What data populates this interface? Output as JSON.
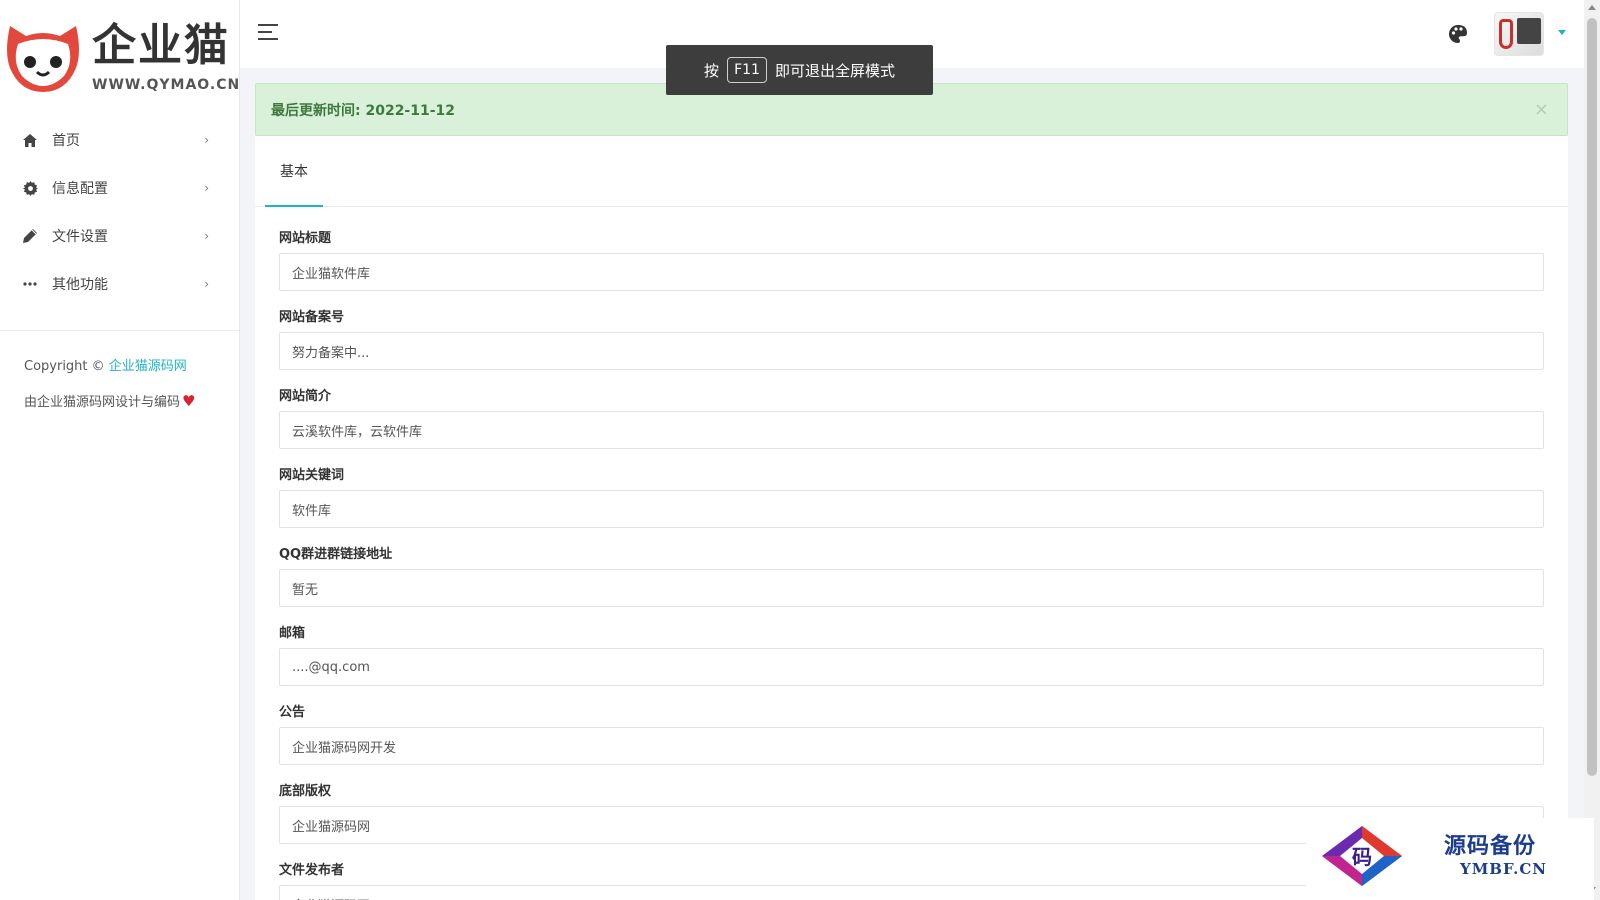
{
  "sidebar": {
    "logo_text": "企业猫",
    "logo_url": "WWW.QYMAO.CN",
    "items": [
      {
        "label": "首页",
        "icon": "home-icon"
      },
      {
        "label": "信息配置",
        "icon": "gear-icon"
      },
      {
        "label": "文件设置",
        "icon": "pencil-icon"
      },
      {
        "label": "其他功能",
        "icon": "more-icon"
      }
    ],
    "copyright_prefix": "Copyright ©",
    "copyright_link": "企业猫源码网",
    "credit": "由企业猫源码网设计与编码"
  },
  "toast": {
    "prefix": "按",
    "key": "F11",
    "suffix": "即可退出全屏模式"
  },
  "alert": {
    "text": "最后更新时间: 2022-11-12",
    "close": "×"
  },
  "tabs": [
    {
      "label": "基本"
    }
  ],
  "form": {
    "fields": [
      {
        "label": "网站标题",
        "value": "企业猫软件库"
      },
      {
        "label": "网站备案号",
        "value": "努力备案中..."
      },
      {
        "label": "网站简介",
        "value": "云溪软件库，云软件库"
      },
      {
        "label": "网站关键词",
        "value": "软件库"
      },
      {
        "label": "QQ群进群链接地址",
        "value": "暂无"
      },
      {
        "label": "邮箱",
        "value": "....@qq.com"
      },
      {
        "label": "公告",
        "value": "企业猫源码网开发"
      },
      {
        "label": "底部版权",
        "value": "企业猫源码网"
      },
      {
        "label": "文件发布者",
        "value": "企业猫源码网"
      }
    ]
  },
  "watermark": {
    "glyph": "码",
    "title": "源码备份",
    "url": "YMBF.CN"
  },
  "colors": {
    "accent": "#21b3c4",
    "alert_bg": "#d9f0d9",
    "alert_text": "#3e7a3e",
    "heart": "#d9232d"
  }
}
